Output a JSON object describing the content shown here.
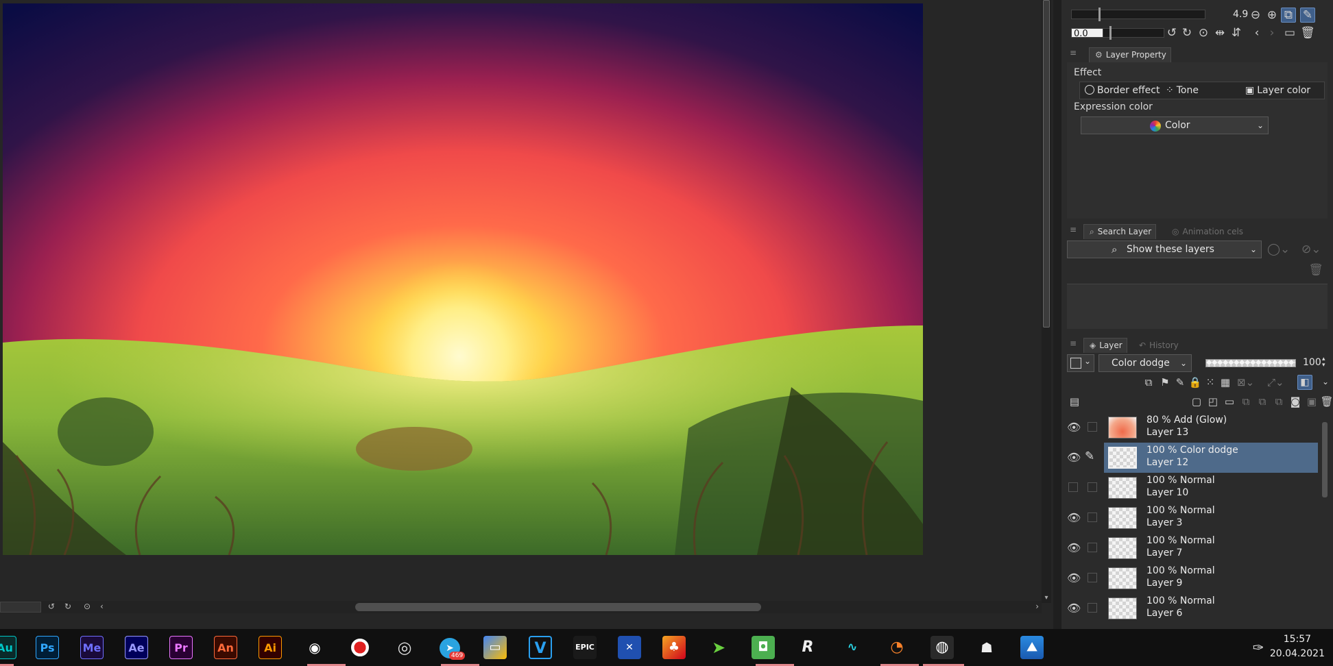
{
  "brush": {
    "size_value": "4.9",
    "second_value": "0.0"
  },
  "layer_property": {
    "tab_label": "Layer Property",
    "effect_label": "Effect",
    "effects": [
      "Border effect",
      "Tone",
      "Layer color"
    ],
    "expression_label": "Expression color",
    "expression_value": "Color"
  },
  "search": {
    "tab_label": "Search Layer",
    "tab2_label": "Animation cels",
    "dropdown_value": "Show these layers"
  },
  "layer_panel": {
    "tab_label": "Layer",
    "tab2_label": "History",
    "blend_mode": "Color dodge",
    "opacity": "100",
    "layers": [
      {
        "mode": "80 % Add (Glow)",
        "name": "Layer 13",
        "visible": true,
        "selected": false
      },
      {
        "mode": "100 % Color dodge",
        "name": "Layer 12",
        "visible": true,
        "selected": true
      },
      {
        "mode": "100 % Normal",
        "name": "Layer 10",
        "visible": false,
        "selected": false
      },
      {
        "mode": "100 % Normal",
        "name": "Layer 3",
        "visible": true,
        "selected": false
      },
      {
        "mode": "100 % Normal",
        "name": "Layer 7",
        "visible": true,
        "selected": false
      },
      {
        "mode": "100 % Normal",
        "name": "Layer 9",
        "visible": true,
        "selected": false
      },
      {
        "mode": "100 % Normal",
        "name": "Layer 6",
        "visible": true,
        "selected": false
      }
    ]
  },
  "taskbar": {
    "apps": [
      {
        "label": "Au",
        "color": "#00c8c8",
        "bg": "#0a2a2a"
      },
      {
        "label": "Ps",
        "color": "#31a8ff",
        "bg": "#001e36"
      },
      {
        "label": "Me",
        "color": "#6f6fff",
        "bg": "#1a0a3a"
      },
      {
        "label": "Ae",
        "color": "#9999ff",
        "bg": "#00005b"
      },
      {
        "label": "Pr",
        "color": "#ea77ff",
        "bg": "#2a0033"
      },
      {
        "label": "An",
        "color": "#ff6a3a",
        "bg": "#3a0a00"
      },
      {
        "label": "Ai",
        "color": "#ff9a00",
        "bg": "#330000"
      }
    ],
    "time": "15:57",
    "date": "20.04.2021",
    "telegram_badge": "469"
  }
}
